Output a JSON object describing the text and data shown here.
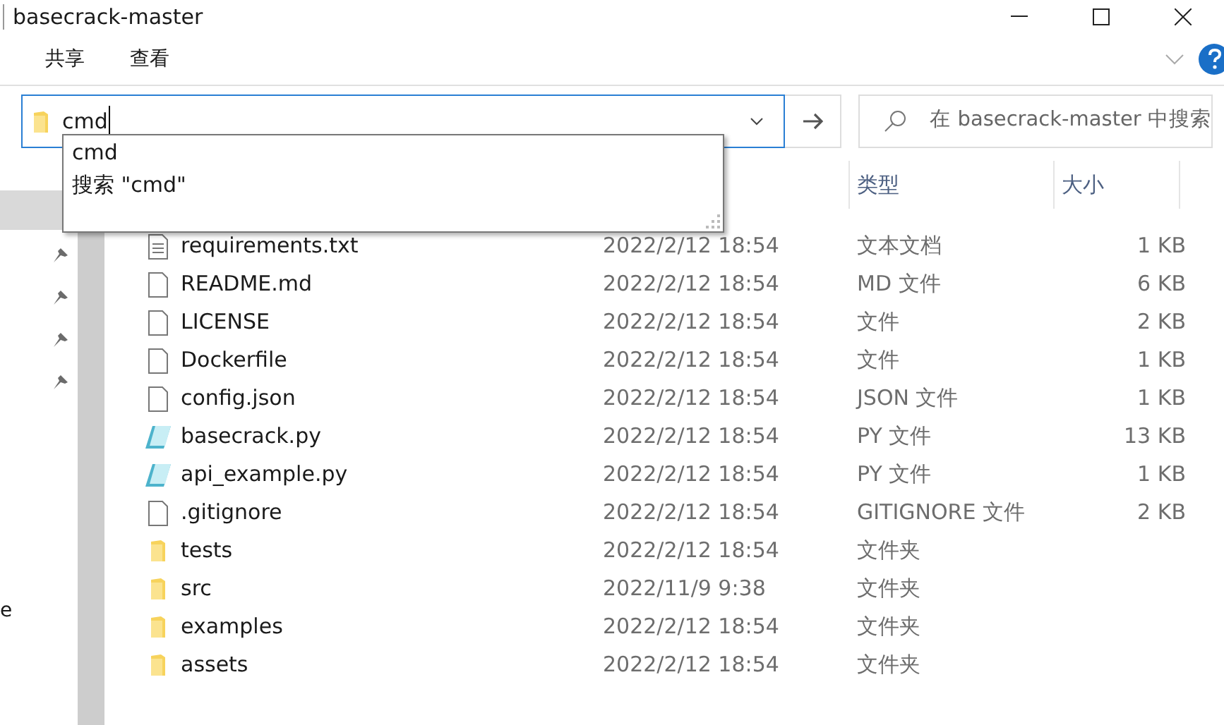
{
  "window": {
    "title": "basecrack-master"
  },
  "ribbon_tabs": [
    "共享",
    "查看"
  ],
  "address": {
    "value": "cmd"
  },
  "autocomplete": [
    "cmd",
    "搜索 \"cmd\""
  ],
  "search": {
    "placeholder": "在 basecrack-master 中搜索"
  },
  "nav_pane": {
    "cut_label": "e"
  },
  "columns": [
    "类型",
    "大小"
  ],
  "rows": [
    {
      "kind": "text",
      "name": "requirements.txt",
      "date": "2022/2/12 18:54",
      "type": "文本文档",
      "size": "1 KB"
    },
    {
      "kind": "file",
      "name": "README.md",
      "date": "2022/2/12 18:54",
      "type": "MD 文件",
      "size": "6 KB"
    },
    {
      "kind": "file",
      "name": "LICENSE",
      "date": "2022/2/12 18:54",
      "type": "文件",
      "size": "2 KB"
    },
    {
      "kind": "file",
      "name": "Dockerfile",
      "date": "2022/2/12 18:54",
      "type": "文件",
      "size": "1 KB"
    },
    {
      "kind": "file",
      "name": "config.json",
      "date": "2022/2/12 18:54",
      "type": "JSON 文件",
      "size": "1 KB"
    },
    {
      "kind": "python",
      "name": "basecrack.py",
      "date": "2022/2/12 18:54",
      "type": "PY 文件",
      "size": "13 KB"
    },
    {
      "kind": "python",
      "name": "api_example.py",
      "date": "2022/2/12 18:54",
      "type": "PY 文件",
      "size": "1 KB"
    },
    {
      "kind": "file",
      "name": ".gitignore",
      "date": "2022/2/12 18:54",
      "type": "GITIGNORE 文件",
      "size": "2 KB"
    },
    {
      "kind": "folder",
      "name": "tests",
      "date": "2022/2/12 18:54",
      "type": "文件夹"
    },
    {
      "kind": "folder",
      "name": "src",
      "date": "2022/11/9 9:38",
      "type": "文件夹"
    },
    {
      "kind": "folder",
      "name": "examples",
      "date": "2022/2/12 18:54",
      "type": "文件夹"
    },
    {
      "kind": "folder",
      "name": "assets",
      "date": "2022/2/12 18:54",
      "type": "文件夹"
    }
  ]
}
